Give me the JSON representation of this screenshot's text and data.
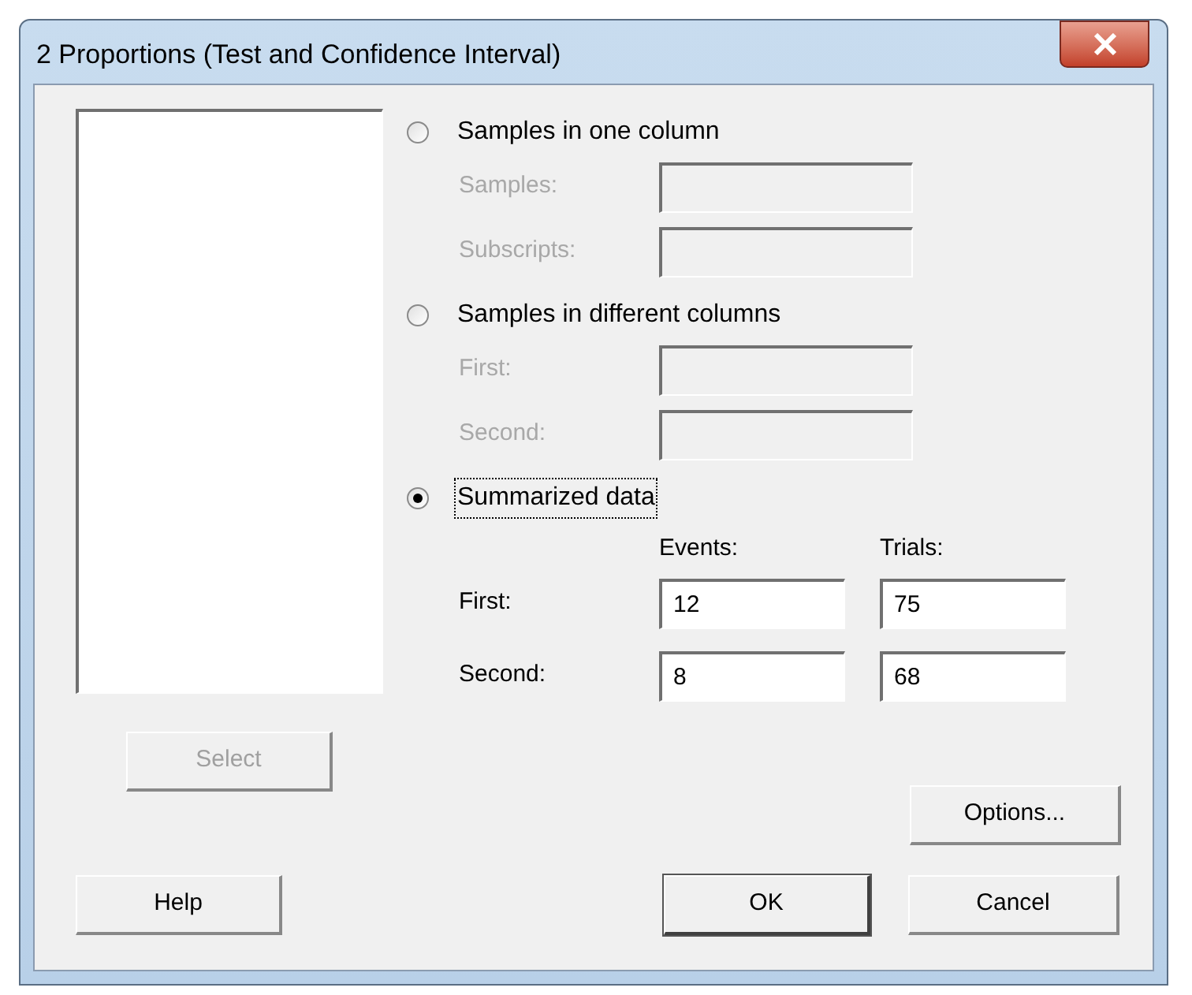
{
  "window": {
    "title": "2 Proportions (Test and Confidence Interval)"
  },
  "sample_modes": [
    {
      "label": "Samples in one column",
      "selected": false,
      "focused": false,
      "fields": [
        {
          "label": "Samples:",
          "disabled": true
        },
        {
          "label": "Subscripts:",
          "disabled": true
        }
      ]
    },
    {
      "label": "Samples in different columns",
      "selected": false,
      "focused": false,
      "fields": [
        {
          "label": "First:",
          "disabled": true
        },
        {
          "label": "Second:",
          "disabled": true
        }
      ]
    },
    {
      "label": "Summarized data",
      "selected": true,
      "focused": true
    }
  ],
  "summary": {
    "columns": [
      "Events:",
      "Trials:"
    ],
    "rows": [
      {
        "label": "First:",
        "values": [
          "12",
          "75"
        ]
      },
      {
        "label": "Second:",
        "values": [
          "8",
          "68"
        ]
      }
    ]
  },
  "select_button": {
    "label": "Select",
    "disabled": true
  },
  "options_button": {
    "label": "Options..."
  },
  "buttons": [
    {
      "label": "Help",
      "default": false
    },
    {
      "label": "OK",
      "default": true
    },
    {
      "label": "Cancel",
      "default": false
    }
  ]
}
